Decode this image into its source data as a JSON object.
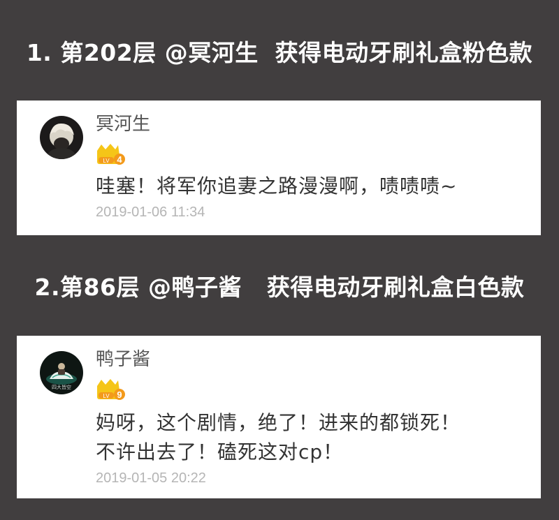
{
  "headings": [
    "1. 第202层 @冥河生  获得电动牙刷礼盒粉色款",
    "2.第86层 @鸭子酱   获得电动牙刷礼盒白色款"
  ],
  "comments": [
    {
      "username": "冥河生",
      "level": "4",
      "level_prefix": "LV",
      "text": "哇塞！将军你追妻之路漫漫啊，啧啧啧~",
      "timestamp": "2019-01-06 11:34"
    },
    {
      "username": "鸭子酱",
      "level": "9",
      "level_prefix": "LV",
      "text": "妈呀，这个剧情，绝了！进来的都锁死！\n不许出去了！磕死这对cp！",
      "timestamp": "2019-01-05 20:22",
      "avatar_caption": "四大皆空"
    }
  ],
  "colors": {
    "background": "#413e3f",
    "card": "#ffffff",
    "badge_gold": "#f5c518",
    "badge_orange": "#f39a1b",
    "timestamp": "#b5b5b5"
  }
}
